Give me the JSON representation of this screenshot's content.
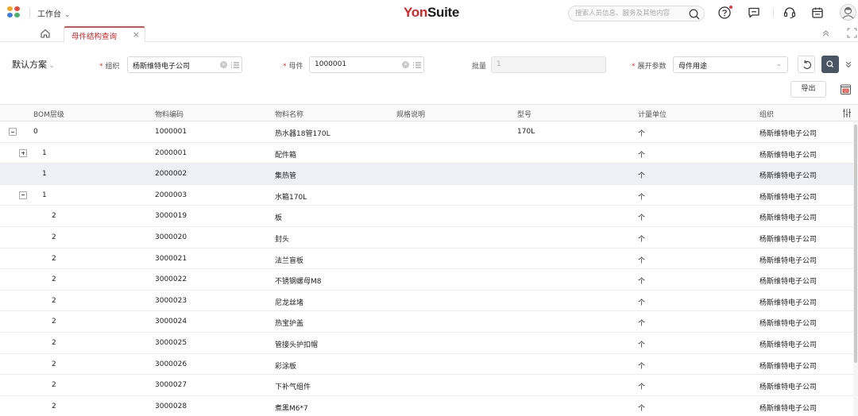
{
  "topbar": {
    "workbench_label": "工作台",
    "brand_part1": "Yon",
    "brand_part2": "Suite",
    "search_placeholder": "搜索人员信息、服务及其他内容",
    "logo_colors": [
      "#f5a623",
      "#e94b3c",
      "#3b7ddd",
      "#45b36b"
    ],
    "icons": [
      "search-icon",
      "help-icon",
      "message-icon",
      "headset-icon",
      "calendar-icon",
      "user-avatar-icon"
    ]
  },
  "tabs": {
    "home_icon": "home-icon",
    "active_tab_label": "母件结构查询",
    "close_symbol": "×"
  },
  "filters": {
    "scheme_label": "默认方案",
    "org_label": "组织",
    "org_value": "杨斯维特电子公司",
    "parent_label": "母件",
    "parent_value": "1000001",
    "batch_label": "批量",
    "batch_value": "1",
    "expand_label": "展开参数",
    "expand_value": "母件用途",
    "export_label": "导出",
    "required_mark": "*",
    "accent_color": "#d8232a"
  },
  "table": {
    "columns": [
      "BOM层级",
      "物料编码",
      "物料名称",
      "规格说明",
      "型号",
      "计量单位",
      "组织"
    ],
    "rows": [
      {
        "expander": "minus",
        "level": "0",
        "code": "1000001",
        "name": "热水器18管170L",
        "spec": "",
        "model": "170L",
        "unit": "个",
        "org": "杨斯维特电子公司",
        "highlight": false
      },
      {
        "expander": "plus",
        "level": "1",
        "code": "2000001",
        "name": "配件箱",
        "spec": "",
        "model": "",
        "unit": "个",
        "org": "杨斯维特电子公司",
        "highlight": false
      },
      {
        "expander": "none",
        "level": "1",
        "code": "2000002",
        "name": "集热管",
        "spec": "",
        "model": "",
        "unit": "个",
        "org": "杨斯维特电子公司",
        "highlight": true
      },
      {
        "expander": "minus",
        "level": "1",
        "code": "2000003",
        "name": "水箱170L",
        "spec": "",
        "model": "",
        "unit": "个",
        "org": "杨斯维特电子公司",
        "highlight": false
      },
      {
        "expander": "none",
        "level": "2",
        "code": "3000019",
        "name": "板",
        "spec": "",
        "model": "",
        "unit": "个",
        "org": "杨斯维特电子公司",
        "highlight": false
      },
      {
        "expander": "none",
        "level": "2",
        "code": "3000020",
        "name": "封头",
        "spec": "",
        "model": "",
        "unit": "个",
        "org": "杨斯维特电子公司",
        "highlight": false
      },
      {
        "expander": "none",
        "level": "2",
        "code": "3000021",
        "name": "法兰盲板",
        "spec": "",
        "model": "",
        "unit": "个",
        "org": "杨斯维特电子公司",
        "highlight": false
      },
      {
        "expander": "none",
        "level": "2",
        "code": "3000022",
        "name": "不锈钢螺母M8",
        "spec": "",
        "model": "",
        "unit": "个",
        "org": "杨斯维特电子公司",
        "highlight": false
      },
      {
        "expander": "none",
        "level": "2",
        "code": "3000023",
        "name": "尼龙丝堵",
        "spec": "",
        "model": "",
        "unit": "个",
        "org": "杨斯维特电子公司",
        "highlight": false
      },
      {
        "expander": "none",
        "level": "2",
        "code": "3000024",
        "name": "热宝护盖",
        "spec": "",
        "model": "",
        "unit": "个",
        "org": "杨斯维特电子公司",
        "highlight": false
      },
      {
        "expander": "none",
        "level": "2",
        "code": "3000025",
        "name": "管接头护扣帽",
        "spec": "",
        "model": "",
        "unit": "个",
        "org": "杨斯维特电子公司",
        "highlight": false
      },
      {
        "expander": "none",
        "level": "2",
        "code": "3000026",
        "name": "彩涂板",
        "spec": "",
        "model": "",
        "unit": "个",
        "org": "杨斯维特电子公司",
        "highlight": false
      },
      {
        "expander": "none",
        "level": "2",
        "code": "3000027",
        "name": "下补气组件",
        "spec": "",
        "model": "",
        "unit": "个",
        "org": "杨斯维特电子公司",
        "highlight": false
      },
      {
        "expander": "none",
        "level": "2",
        "code": "3000028",
        "name": "煮黑M6*7",
        "spec": "",
        "model": "",
        "unit": "个",
        "org": "杨斯维特电子公司",
        "highlight": false
      }
    ]
  }
}
